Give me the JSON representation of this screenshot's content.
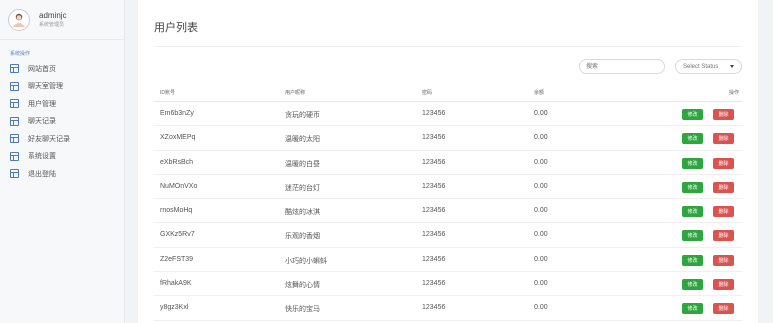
{
  "user": {
    "name": "adminjc",
    "role": "系统管理员"
  },
  "sidebar": {
    "section_title": "系统操作",
    "items": [
      {
        "label": "网站首页"
      },
      {
        "label": "聊天室管理"
      },
      {
        "label": "用户管理"
      },
      {
        "label": "聊天记录"
      },
      {
        "label": "好友聊天记录"
      },
      {
        "label": "系统设置"
      },
      {
        "label": "退出登陆"
      }
    ]
  },
  "main": {
    "title": "用户列表",
    "search_placeholder": "搜索",
    "status_select": "Select Status"
  },
  "table": {
    "headers": {
      "id": "ID账号",
      "nickname": "用户昵称",
      "password": "密码",
      "balance": "余额",
      "actions": "操作"
    },
    "edit_label": "修改",
    "delete_label": "删除",
    "rows": [
      {
        "id": "Em6b3nZy",
        "nickname": "贪玩的硬币",
        "password": "123456",
        "balance": "0.00"
      },
      {
        "id": "XZoxMEPq",
        "nickname": "温暖的太阳",
        "password": "123456",
        "balance": "0.00"
      },
      {
        "id": "eXbRsBch",
        "nickname": "温暖的白昼",
        "password": "123456",
        "balance": "0.00"
      },
      {
        "id": "NuMOnVXo",
        "nickname": "迷茫的台灯",
        "password": "123456",
        "balance": "0.00"
      },
      {
        "id": "rnosMoHq",
        "nickname": "酷炫的冰淇",
        "password": "123456",
        "balance": "0.00"
      },
      {
        "id": "GXKz5Rv7",
        "nickname": "乐观的香烟",
        "password": "123456",
        "balance": "0.00"
      },
      {
        "id": "Z2eFST39",
        "nickname": "小巧的小蝌蚪",
        "password": "123456",
        "balance": "0.00"
      },
      {
        "id": "fRhakA9K",
        "nickname": "炫舞的心情",
        "password": "123456",
        "balance": "0.00"
      },
      {
        "id": "y8gz3Kxl",
        "nickname": "快乐的宝马",
        "password": "123456",
        "balance": "0.00"
      }
    ]
  }
}
